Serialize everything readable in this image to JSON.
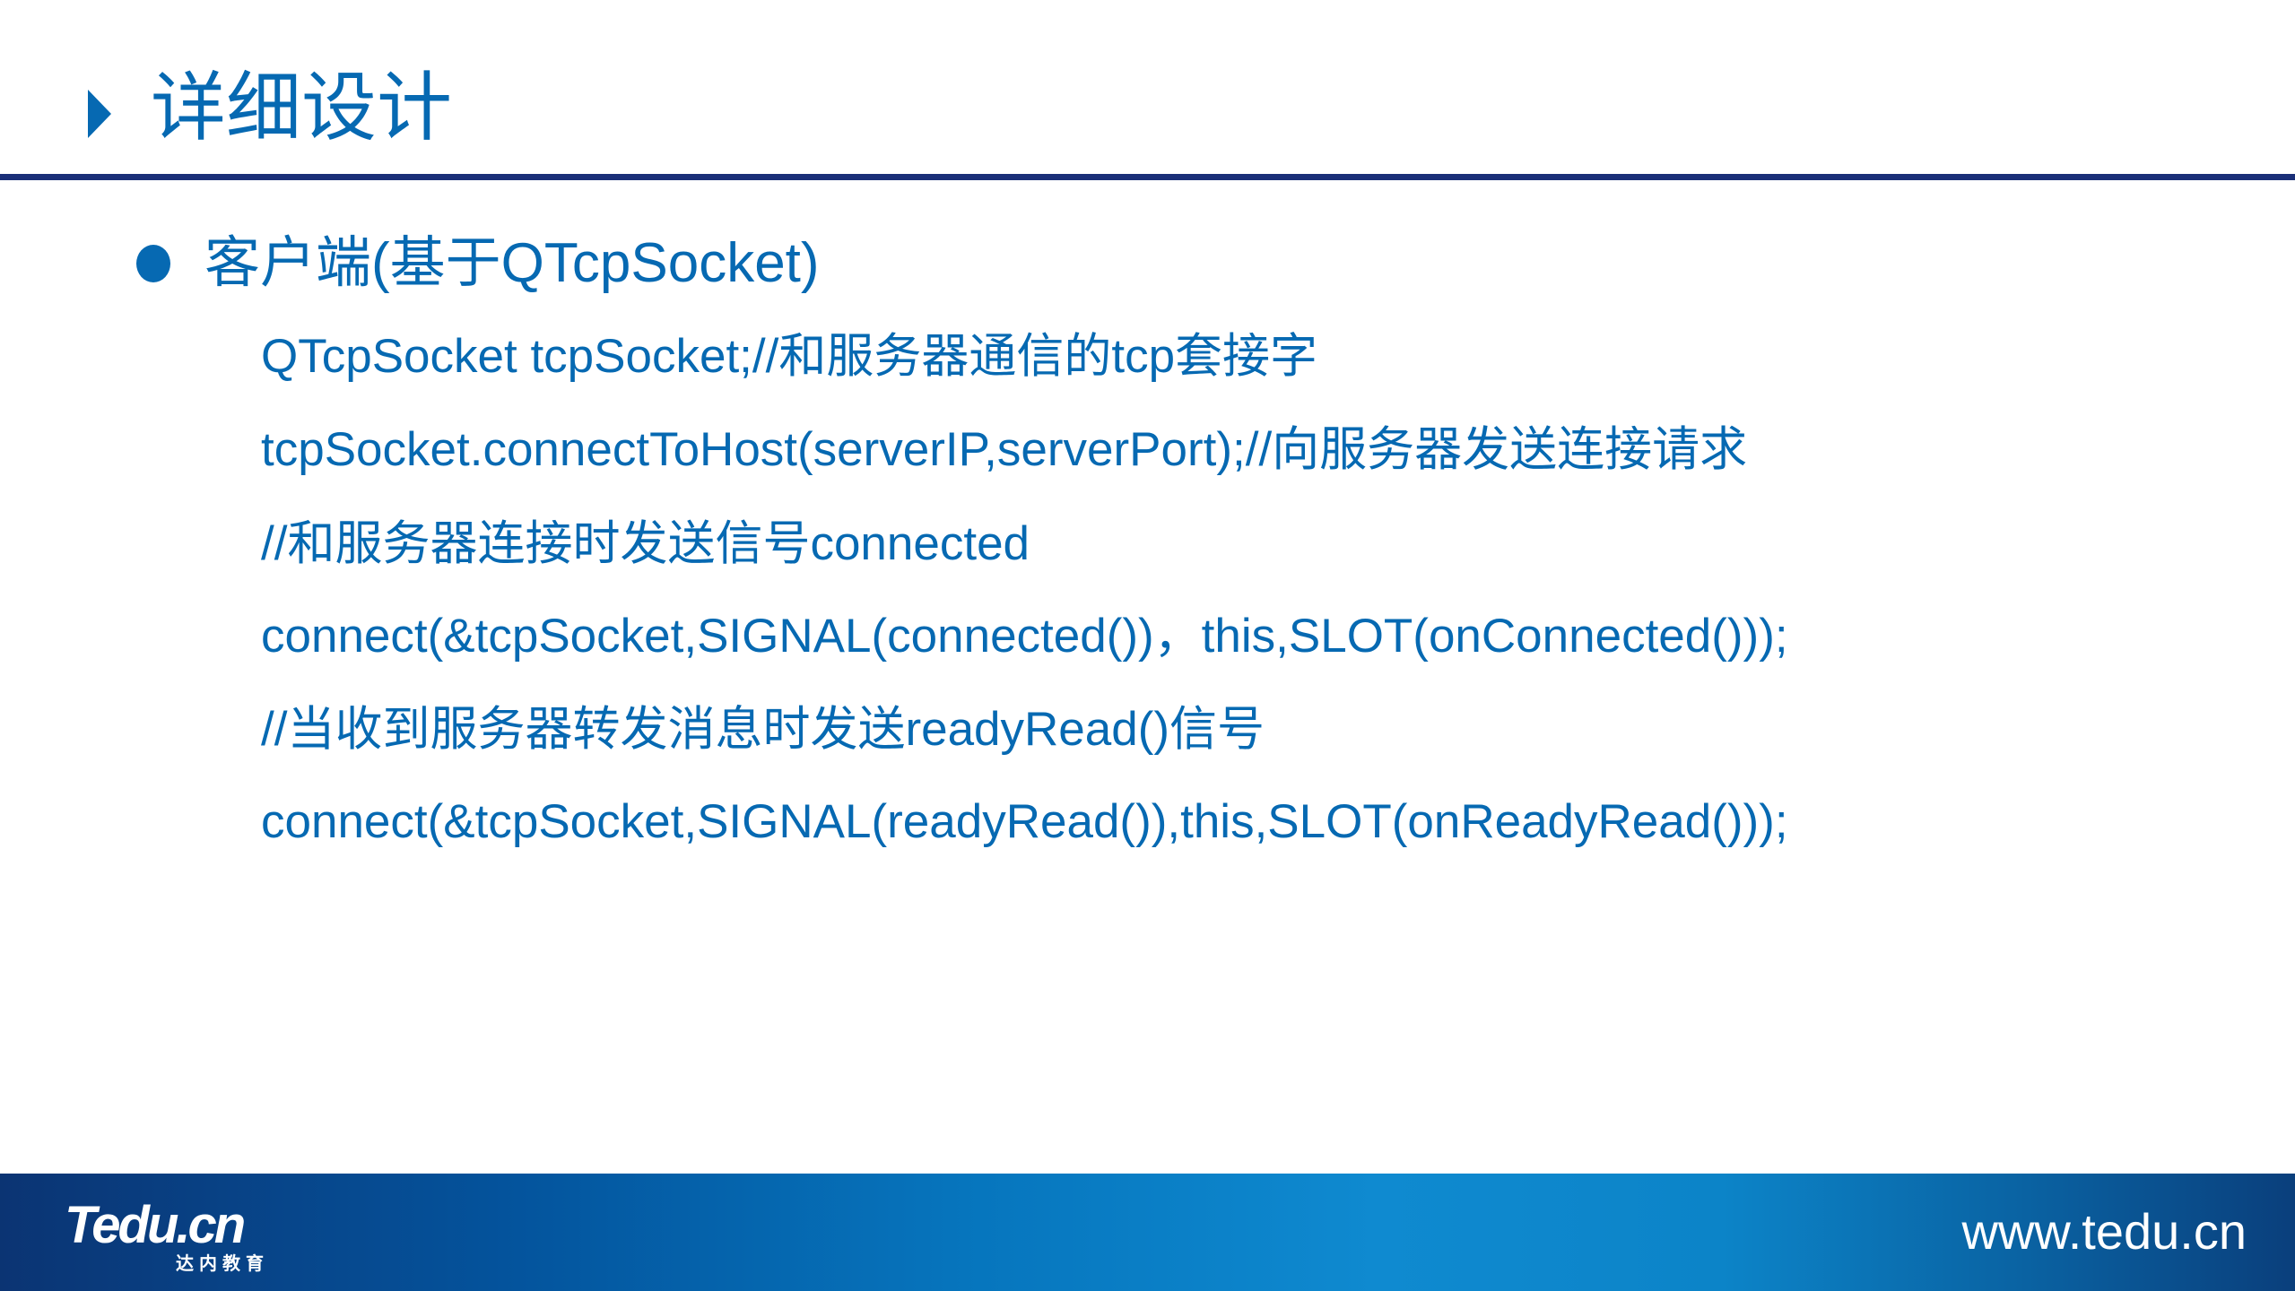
{
  "header": {
    "title": "详细设计",
    "marker_icon": "triangle-right-icon"
  },
  "content": {
    "bullet": "客户端(基于QTcpSocket)",
    "code_lines": [
      "QTcpSocket tcpSocket;//和服务器通信的tcp套接字",
      "tcpSocket.connectToHost(serverIP,serverPort);//向服务器发送连接请求",
      "//和服务器连接时发送信号connected",
      "connect(&tcpSocket,SIGNAL(connected())，this,SLOT(onConnected()));",
      "//当收到服务器转发消息时发送readyRead()信号",
      "connect(&tcpSocket,SIGNAL(readyRead()),this,SLOT(onReadyRead()));"
    ]
  },
  "footer": {
    "logo": "Tedu.cn",
    "logo_sub": "达内教育",
    "url": "www.tedu.cn"
  },
  "colors": {
    "text": "#0669b2",
    "divider": "#1a2f78",
    "footer_dark": "#0b3473",
    "footer_light": "#0f8ad0"
  }
}
